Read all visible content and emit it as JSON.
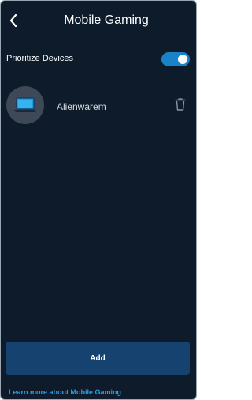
{
  "header": {
    "title": "Mobile Gaming",
    "back_icon": "chevron-left-icon"
  },
  "prioritize": {
    "label": "Prioritize Devices",
    "enabled": true
  },
  "devices": [
    {
      "name": "Alienwarem",
      "icon": "laptop-icon"
    }
  ],
  "actions": {
    "add_label": "Add",
    "learn_more_label": "Learn more about Mobile Gaming"
  },
  "colors": {
    "background": "#0d1b2a",
    "accent": "#1a82c7",
    "button": "#15426e",
    "link": "#2a9ee6"
  }
}
